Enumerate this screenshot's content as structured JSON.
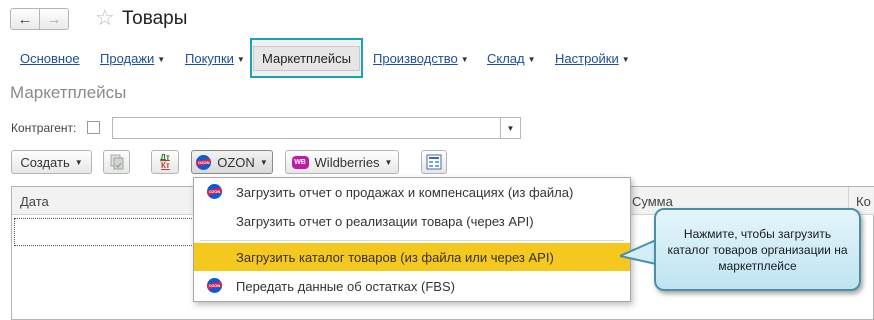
{
  "window": {
    "title": "Товары"
  },
  "tabs": [
    {
      "label": "Основное",
      "has_arrow": false
    },
    {
      "label": "Продажи",
      "has_arrow": true
    },
    {
      "label": "Покупки",
      "has_arrow": true
    },
    {
      "label": "Маркетплейсы",
      "active": true
    },
    {
      "label": "Производство",
      "has_arrow": true
    },
    {
      "label": "Склад",
      "has_arrow": true
    },
    {
      "label": "Настройки",
      "has_arrow": true
    }
  ],
  "section": {
    "title": "Маркетплейсы"
  },
  "filter": {
    "label": "Контрагент:",
    "value": ""
  },
  "toolbar": {
    "create_label": "Создать",
    "dtkt_label_top": "Дт",
    "dtkt_label_bottom": "Кт",
    "ozon_label": "OZON",
    "wb_label": "Wildberries"
  },
  "table": {
    "columns": [
      "Дата",
      "Сумма",
      "Ко"
    ]
  },
  "ozon_menu": {
    "items": [
      {
        "label": "Загрузить отчет о продажах и компенсациях (из файла)",
        "icon": "ozon-icon"
      },
      {
        "label": "Загрузить отчет о реализации товара  (через API)",
        "icon": ""
      },
      {
        "label": "Загрузить каталог товаров (из файла или через API)",
        "icon": "",
        "highlighted": true
      },
      {
        "label": "Передать данные об остатках (FBS)",
        "icon": "ozon-icon"
      }
    ]
  },
  "callout": {
    "text": "Нажмите, чтобы загрузить каталог товаров организации на маркетплейсе"
  },
  "colors": {
    "highlight": "#f4c81e",
    "active_tab_border": "#1aa3b5",
    "callout_border": "#4a8fa8",
    "link": "#1c4f9c"
  }
}
